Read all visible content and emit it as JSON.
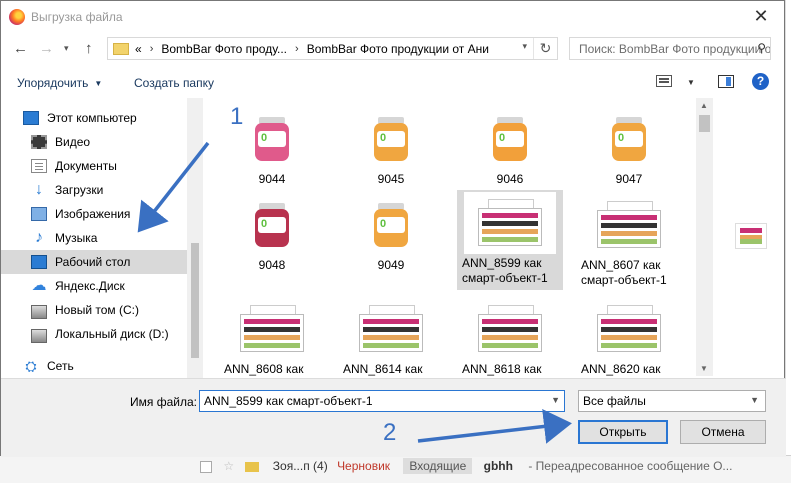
{
  "window": {
    "title": "Выгрузка файла",
    "close_glyph": "✕"
  },
  "address": {
    "overflow": "«",
    "path": [
      "BombBar Фото проду...",
      "BombBar Фото продукции от Ани"
    ],
    "search_placeholder": "Поиск: BombBar Фото продукции от Ани"
  },
  "toolbar": {
    "organize_label": "Упорядочить",
    "new_folder_label": "Создать папку",
    "help_label": "?"
  },
  "sidebar": {
    "items": [
      {
        "label": "Этот компьютер",
        "icon": "computer-icon"
      },
      {
        "label": "Видео",
        "icon": "video-icon"
      },
      {
        "label": "Документы",
        "icon": "documents-icon"
      },
      {
        "label": "Загрузки",
        "icon": "downloads-icon"
      },
      {
        "label": "Изображения",
        "icon": "pictures-icon"
      },
      {
        "label": "Музыка",
        "icon": "music-icon"
      },
      {
        "label": "Рабочий стол",
        "icon": "desktop-icon",
        "selected": true
      },
      {
        "label": "Яндекс.Диск",
        "icon": "yandex-disk-icon"
      },
      {
        "label": "Новый том (C:)",
        "icon": "drive-icon"
      },
      {
        "label": "Локальный диск (D:)",
        "icon": "drive-icon"
      },
      {
        "label": "Сеть",
        "icon": "network-icon"
      }
    ]
  },
  "files": [
    {
      "name": "9044",
      "type": "jar",
      "color": "#e05a8b"
    },
    {
      "name": "9045",
      "type": "jar",
      "color": "#f0a640"
    },
    {
      "name": "9046",
      "type": "jar",
      "color": "#f2a03a"
    },
    {
      "name": "9047",
      "type": "jar",
      "color": "#f0a640"
    },
    {
      "name": "9048",
      "type": "jar",
      "color": "#b8334f"
    },
    {
      "name": "9049",
      "type": "jar",
      "color": "#f0a640"
    },
    {
      "name": "ANN_8599 как смарт-объект-1",
      "type": "box",
      "selected": true
    },
    {
      "name": "ANN_8607 как смарт-объект-1",
      "type": "box"
    },
    {
      "name": "ANN_8608 как",
      "type": "box"
    },
    {
      "name": "ANN_8614 как",
      "type": "box"
    },
    {
      "name": "ANN_8618 как",
      "type": "box"
    },
    {
      "name": "ANN_8620 как",
      "type": "box"
    }
  ],
  "footer": {
    "filename_label": "Имя файла:",
    "filename_value": "ANN_8599 как смарт-объект-1",
    "filetype_value": "Все файлы",
    "open_label": "Открыть",
    "cancel_label": "Отмена"
  },
  "annotations": {
    "step1": "1",
    "step2": "2",
    "color": "#3a70c2"
  },
  "background_mail": {
    "sender_prefix": "Зоя...п (4)",
    "draft": "Черновик",
    "tag": "Входящие",
    "sender": "gbhh",
    "subject": "- Переадресованное сообщение О..."
  }
}
